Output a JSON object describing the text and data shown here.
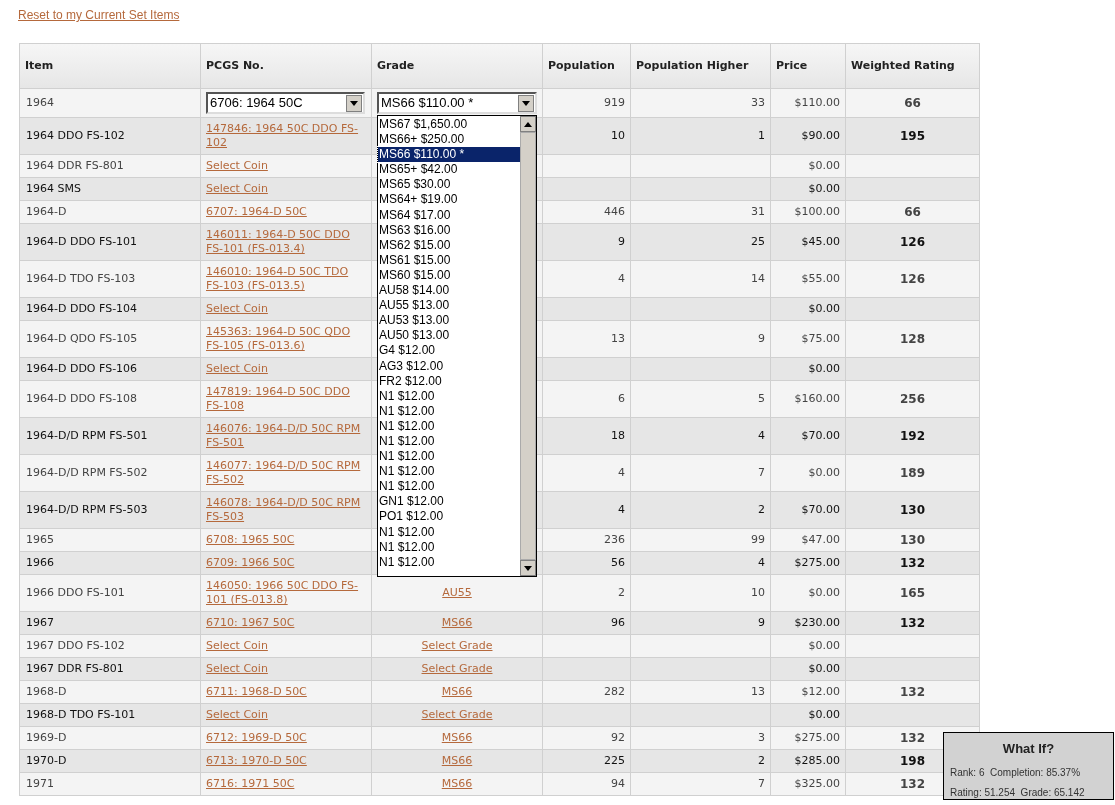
{
  "reset_link": "Reset to my Current Set Items",
  "table": {
    "columns": [
      "Item",
      "PCGS No.",
      "Grade",
      "Population",
      "Population Higher",
      "Price",
      "Weighted Rating"
    ],
    "rows": [
      {
        "item": "1964",
        "pcgs": {
          "kind": "select",
          "text": "6706: 1964 50C"
        },
        "grade": {
          "kind": "select",
          "text": "MS66 $110.00 *"
        },
        "population": "919",
        "population_higher": "33",
        "price": "$110.00",
        "rating": "66"
      },
      {
        "item": "1964 DDO FS-102",
        "pcgs": {
          "kind": "link",
          "text": "147846: 1964 50C DDO FS-102"
        },
        "population": "10",
        "population_higher": "1",
        "price": "$90.00",
        "rating": "195"
      },
      {
        "item": "1964 DDR FS-801",
        "pcgs": {
          "kind": "link",
          "text": "Select Coin"
        },
        "price": "$0.00"
      },
      {
        "item": "1964 SMS",
        "pcgs": {
          "kind": "link",
          "text": "Select Coin"
        },
        "price": "$0.00"
      },
      {
        "item": "1964-D",
        "pcgs": {
          "kind": "link",
          "text": "6707: 1964-D 50C"
        },
        "population": "446",
        "population_higher": "31",
        "price": "$100.00",
        "rating": "66"
      },
      {
        "item": "1964-D DDO FS-101",
        "pcgs": {
          "kind": "link",
          "text": "146011: 1964-D 50C DDO FS-101 (FS-013.4)"
        },
        "population": "9",
        "population_higher": "25",
        "price": "$45.00",
        "rating": "126"
      },
      {
        "item": "1964-D TDO FS-103",
        "pcgs": {
          "kind": "link",
          "text": "146010: 1964-D 50C TDO FS-103 (FS-013.5)"
        },
        "population": "4",
        "population_higher": "14",
        "price": "$55.00",
        "rating": "126"
      },
      {
        "item": "1964-D DDO FS-104",
        "pcgs": {
          "kind": "link",
          "text": "Select Coin"
        },
        "price": "$0.00"
      },
      {
        "item": "1964-D QDO FS-105",
        "pcgs": {
          "kind": "link",
          "text": "145363: 1964-D 50C QDO FS-105 (FS-013.6)"
        },
        "population": "13",
        "population_higher": "9",
        "price": "$75.00",
        "rating": "128"
      },
      {
        "item": "1964-D DDO FS-106",
        "pcgs": {
          "kind": "link",
          "text": "Select Coin"
        },
        "price": "$0.00"
      },
      {
        "item": "1964-D DDO FS-108",
        "pcgs": {
          "kind": "link",
          "text": "147819: 1964-D 50C DDO FS-108"
        },
        "population": "6",
        "population_higher": "5",
        "price": "$160.00",
        "rating": "256"
      },
      {
        "item": "1964-D/D RPM FS-501",
        "pcgs": {
          "kind": "link",
          "text": "146076: 1964-D/D 50C RPM FS-501"
        },
        "population": "18",
        "population_higher": "4",
        "price": "$70.00",
        "rating": "192"
      },
      {
        "item": "1964-D/D RPM FS-502",
        "pcgs": {
          "kind": "link",
          "text": "146077: 1964-D/D 50C RPM FS-502"
        },
        "population": "4",
        "population_higher": "7",
        "price": "$0.00",
        "rating": "189"
      },
      {
        "item": "1964-D/D RPM FS-503",
        "pcgs": {
          "kind": "link",
          "text": "146078: 1964-D/D 50C RPM FS-503"
        },
        "population": "4",
        "population_higher": "2",
        "price": "$70.00",
        "rating": "130"
      },
      {
        "item": "1965",
        "pcgs": {
          "kind": "link",
          "text": "6708: 1965 50C"
        },
        "population": "236",
        "population_higher": "99",
        "price": "$47.00",
        "rating": "130"
      },
      {
        "item": "1966",
        "pcgs": {
          "kind": "link",
          "text": "6709: 1966 50C"
        },
        "population": "56",
        "population_higher": "4",
        "price": "$275.00",
        "rating": "132"
      },
      {
        "item": "1966 DDO FS-101",
        "pcgs": {
          "kind": "link",
          "text": "146050: 1966 50C DDO FS-101 (FS-013.8)"
        },
        "grade": {
          "kind": "link",
          "text": "AU55"
        },
        "population": "2",
        "population_higher": "10",
        "price": "$0.00",
        "rating": "165"
      },
      {
        "item": "1967",
        "pcgs": {
          "kind": "link",
          "text": "6710: 1967 50C"
        },
        "grade": {
          "kind": "link",
          "text": "MS66"
        },
        "population": "96",
        "population_higher": "9",
        "price": "$230.00",
        "rating": "132"
      },
      {
        "item": "1967 DDO FS-102",
        "pcgs": {
          "kind": "link",
          "text": "Select Coin"
        },
        "grade": {
          "kind": "link",
          "text": "Select Grade"
        },
        "price": "$0.00"
      },
      {
        "item": "1967 DDR FS-801",
        "pcgs": {
          "kind": "link",
          "text": "Select Coin"
        },
        "grade": {
          "kind": "link",
          "text": "Select Grade"
        },
        "price": "$0.00"
      },
      {
        "item": "1968-D",
        "pcgs": {
          "kind": "link",
          "text": "6711: 1968-D 50C"
        },
        "grade": {
          "kind": "link",
          "text": "MS66"
        },
        "population": "282",
        "population_higher": "13",
        "price": "$12.00",
        "rating": "132"
      },
      {
        "item": "1968-D TDO FS-101",
        "pcgs": {
          "kind": "link",
          "text": "Select Coin"
        },
        "grade": {
          "kind": "link",
          "text": "Select Grade"
        },
        "price": "$0.00"
      },
      {
        "item": "1969-D",
        "pcgs": {
          "kind": "link",
          "text": "6712: 1969-D 50C"
        },
        "grade": {
          "kind": "link",
          "text": "MS66"
        },
        "population": "92",
        "population_higher": "3",
        "price": "$275.00",
        "rating": "132"
      },
      {
        "item": "1970-D",
        "pcgs": {
          "kind": "link",
          "text": "6713: 1970-D 50C"
        },
        "grade": {
          "kind": "link",
          "text": "MS66"
        },
        "population": "225",
        "population_higher": "2",
        "price": "$285.00",
        "rating": "198"
      },
      {
        "item": "1971",
        "pcgs": {
          "kind": "link",
          "text": "6716: 1971 50C"
        },
        "grade": {
          "kind": "link",
          "text": "MS66"
        },
        "population": "94",
        "population_higher": "7",
        "price": "$325.00",
        "rating": "132"
      }
    ]
  },
  "grade_dropdown": {
    "options": [
      {
        "label": "MS67 $1,650.00",
        "selected": false
      },
      {
        "label": "MS66+ $250.00",
        "selected": false
      },
      {
        "label": "MS66 $110.00 *",
        "selected": true
      },
      {
        "label": "MS65+ $42.00",
        "selected": false
      },
      {
        "label": "MS65 $30.00",
        "selected": false
      },
      {
        "label": "MS64+ $19.00",
        "selected": false
      },
      {
        "label": "MS64 $17.00",
        "selected": false
      },
      {
        "label": "MS63 $16.00",
        "selected": false
      },
      {
        "label": "MS62 $15.00",
        "selected": false
      },
      {
        "label": "MS61 $15.00",
        "selected": false
      },
      {
        "label": "MS60 $15.00",
        "selected": false
      },
      {
        "label": "AU58 $14.00",
        "selected": false
      },
      {
        "label": "AU55 $13.00",
        "selected": false
      },
      {
        "label": "AU53 $13.00",
        "selected": false
      },
      {
        "label": "AU50 $13.00",
        "selected": false
      },
      {
        "label": "G4 $12.00",
        "selected": false
      },
      {
        "label": "AG3 $12.00",
        "selected": false
      },
      {
        "label": "FR2 $12.00",
        "selected": false
      },
      {
        "label": "N1 $12.00",
        "selected": false
      },
      {
        "label": "N1 $12.00",
        "selected": false
      },
      {
        "label": "N1 $12.00",
        "selected": false
      },
      {
        "label": "N1 $12.00",
        "selected": false
      },
      {
        "label": "N1 $12.00",
        "selected": false
      },
      {
        "label": "N1 $12.00",
        "selected": false
      },
      {
        "label": "N1 $12.00",
        "selected": false
      },
      {
        "label": "GN1 $12.00",
        "selected": false
      },
      {
        "label": "PO1 $12.00",
        "selected": false
      },
      {
        "label": "N1 $12.00",
        "selected": false
      },
      {
        "label": "N1 $12.00",
        "selected": false
      },
      {
        "label": "N1 $12.00",
        "selected": false
      }
    ]
  },
  "what_if": {
    "title": "What If?",
    "line_1": "Rank: 6  Completion: 85.37%",
    "line_2": "Rating: 51.254  Grade: 65.142"
  }
}
